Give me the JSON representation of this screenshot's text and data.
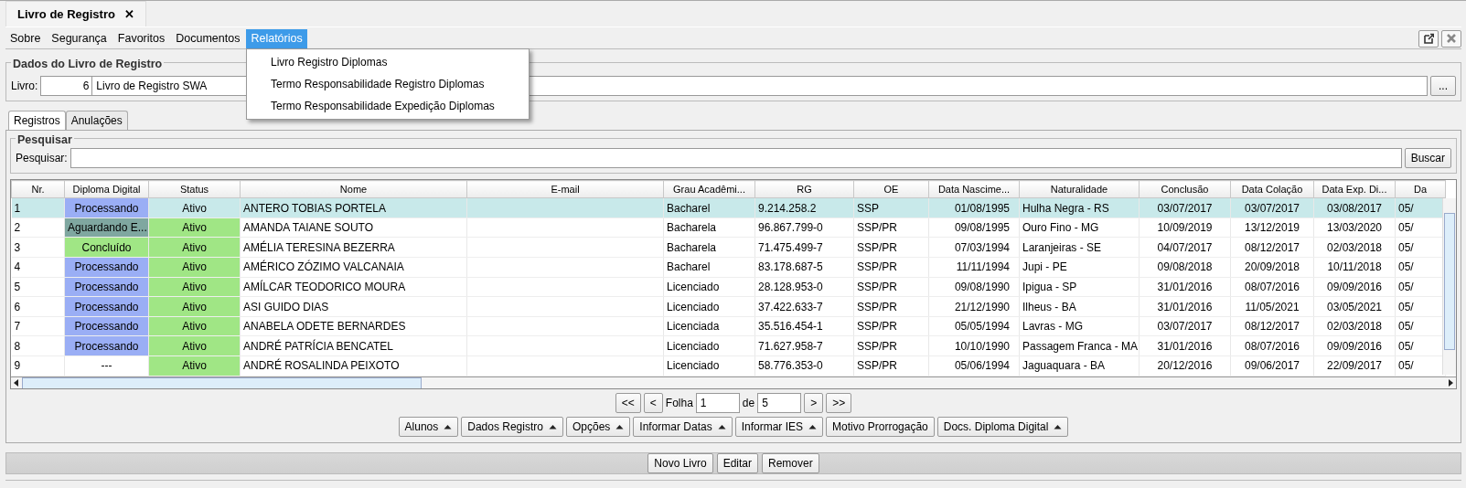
{
  "window": {
    "tab_title": "Livro de Registro",
    "close_glyph": "✕"
  },
  "menu": [
    {
      "label": "Sobre",
      "selected": false
    },
    {
      "label": "Segurança",
      "selected": false
    },
    {
      "label": "Favoritos",
      "selected": false
    },
    {
      "label": "Documentos",
      "selected": false
    },
    {
      "label": "Relatórios",
      "selected": true,
      "submenu": [
        "Livro Registro Diplomas",
        "Termo Responsabilidade Registro Diplomas",
        "Termo Responsabilidade Expedição Diplomas"
      ]
    }
  ],
  "book_group": {
    "title": "Dados do Livro de Registro",
    "label": "Livro:",
    "number": "6",
    "name": "Livro de Registro SWA",
    "browse_button": "..."
  },
  "tabs": [
    {
      "label": "Registros",
      "selected": true
    },
    {
      "label": "Anulações",
      "selected": false
    }
  ],
  "search": {
    "group_title": "Pesquisar",
    "label": "Pesquisar:",
    "button": "Buscar"
  },
  "table": {
    "columns": [
      "Nr.",
      "Diploma Digital",
      "Status",
      "Nome",
      "E-mail",
      "Grau Acadêmi...",
      "RG",
      "OE",
      "Data Nascime...",
      "Naturalidade",
      "Conclusão",
      "Data Colação",
      "Data Exp. Di...",
      "Da"
    ],
    "rows": [
      {
        "selected": true,
        "color": "#9aaef5",
        "cells": [
          "1",
          "Processando",
          "Ativo",
          "ANTERO TOBIAS PORTELA",
          "",
          "Bacharel",
          "9.214.258.2",
          "SSP",
          "01/08/1995",
          "Hulha Negra - RS",
          "03/07/2017",
          "03/07/2017",
          "03/08/2017",
          "05/"
        ]
      },
      {
        "selected": false,
        "color": "#7fa7a0",
        "cells": [
          "2",
          "Aguardando E...",
          "Ativo",
          "AMANDA TAIANE SOUTO",
          "",
          "Bacharela",
          "96.867.799-0",
          "SSP/PR",
          "09/08/1995",
          "Ouro Fino - MG",
          "10/09/2019",
          "13/12/2019",
          "13/03/2020",
          "05/"
        ]
      },
      {
        "selected": false,
        "color": "#a0e685",
        "cells": [
          "3",
          "Concluído",
          "Ativo",
          "AMÉLIA TERESINA BEZERRA",
          "",
          "Bacharela",
          "71.475.499-7",
          "SSP/PR",
          "07/03/1994",
          "Laranjeiras - SE",
          "04/07/2017",
          "08/12/2017",
          "02/03/2018",
          "05/"
        ]
      },
      {
        "selected": false,
        "color": "#9aaef5",
        "cells": [
          "4",
          "Processando",
          "Ativo",
          "AMÉRICO ZÓZIMO VALCANAIA",
          "",
          "Bacharel",
          "83.178.687-5",
          "SSP/PR",
          "11/11/1994",
          "Jupi - PE",
          "09/08/2018",
          "20/09/2018",
          "10/11/2018",
          "05/"
        ]
      },
      {
        "selected": false,
        "color": "#9aaef5",
        "cells": [
          "5",
          "Processando",
          "Ativo",
          "AMÍLCAR TEODORICO MOURA",
          "",
          "Licenciado",
          "28.128.953-0",
          "SSP/PR",
          "09/08/1990",
          "Ipigua - SP",
          "31/01/2016",
          "08/07/2016",
          "09/09/2016",
          "05/"
        ]
      },
      {
        "selected": false,
        "color": "#9aaef5",
        "cells": [
          "6",
          "Processando",
          "Ativo",
          "ASI GUIDO DIAS",
          "",
          "Licenciado",
          "37.422.633-7",
          "SSP/PR",
          "21/12/1990",
          "Ilheus - BA",
          "31/01/2016",
          "11/05/2021",
          "03/05/2021",
          "05/"
        ]
      },
      {
        "selected": false,
        "color": "#9aaef5",
        "cells": [
          "7",
          "Processando",
          "Ativo",
          "ANABELA ODETE BERNARDES",
          "",
          "Licenciada",
          "35.516.454-1",
          "SSP/PR",
          "05/05/1994",
          "Lavras - MG",
          "03/07/2017",
          "08/12/2017",
          "02/03/2018",
          "05/"
        ]
      },
      {
        "selected": false,
        "color": "#9aaef5",
        "cells": [
          "8",
          "Processando",
          "Ativo",
          "ANDRÉ PATRÍCIA BENCATEL",
          "",
          "Licenciado",
          "71.627.958-7",
          "SSP/PR",
          "10/10/1990",
          "Passagem Franca - MA",
          "31/01/2016",
          "08/07/2016",
          "09/09/2016",
          "05/"
        ]
      },
      {
        "selected": false,
        "color": "#ffffff",
        "cells": [
          "9",
          "---",
          "Ativo",
          "ANDRÉ ROSALINDA PEIXOTO",
          "",
          "Licenciado",
          "58.776.353-0",
          "SSP/PR",
          "05/06/1994",
          "Jaguaquara - BA",
          "20/12/2016",
          "09/06/2017",
          "22/09/2017",
          "05/"
        ]
      }
    ]
  },
  "pager": {
    "first": "<<",
    "prev": "<",
    "label": "Folha",
    "page": "1",
    "of_label": "de",
    "total": "5",
    "next": ">",
    "last": ">>"
  },
  "actions": [
    {
      "label": "Alunos",
      "kind": "dropdown"
    },
    {
      "label": "Dados Registro",
      "kind": "dropdown"
    },
    {
      "label": "Opções",
      "kind": "dropdown"
    },
    {
      "label": "Informar Datas",
      "kind": "dropdown"
    },
    {
      "label": "Informar IES",
      "kind": "dropdown"
    },
    {
      "label": "Motivo Prorrogação",
      "kind": "plain"
    },
    {
      "label": "Docs. Diploma Digital",
      "kind": "dropdown"
    }
  ],
  "footer_buttons": [
    "Novo Livro",
    "Editar",
    "Remover"
  ]
}
